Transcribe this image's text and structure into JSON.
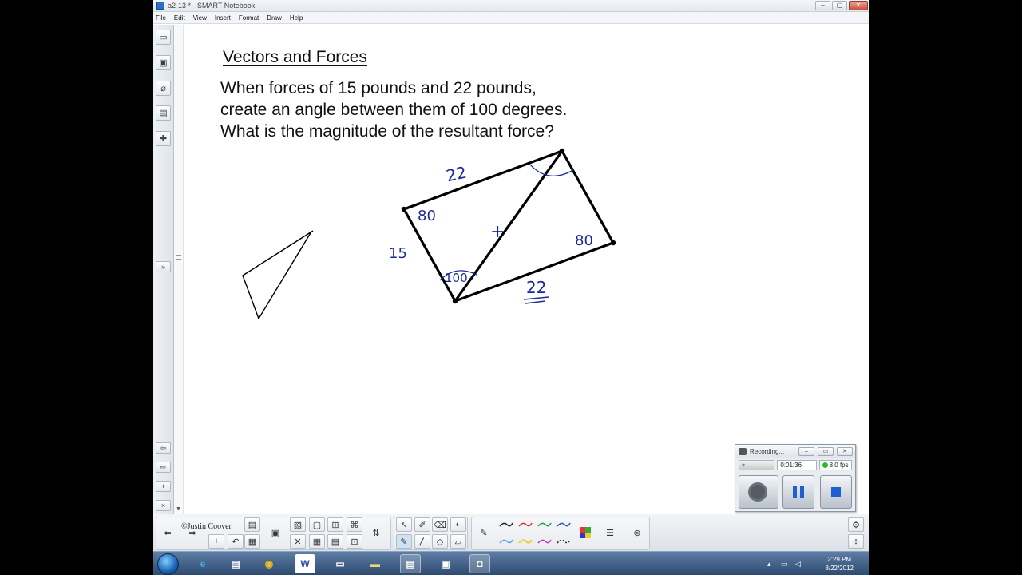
{
  "window": {
    "title": "a2-13 * - SMART Notebook",
    "min_glyph": "‒",
    "max_glyph": "▢",
    "close_glyph": "✕"
  },
  "menu": [
    "File",
    "Edit",
    "View",
    "Insert",
    "Format",
    "Draw",
    "Help"
  ],
  "slide": {
    "title": "Vectors and Forces",
    "problem": [
      "When forces of 15 pounds and 22 pounds,",
      "create an angle between them of 100 degrees.",
      "What is the magnitude of the resultant force?"
    ]
  },
  "annotations": {
    "top_side": "22",
    "left_angle": "80",
    "left_side": "15",
    "bottom_angle": "100",
    "diagonal_mark": "+",
    "right_angle": "80",
    "bottom_side": "22"
  },
  "recorder": {
    "title": "Recording...",
    "elapsed": "0:01:36",
    "fps": "8.0 fps"
  },
  "toolbar": {
    "copyright": "©Justin Coover"
  },
  "taskbar": {
    "time": "2:29 PM",
    "date": "8/22/2012",
    "word_glyph": "W"
  },
  "colors": {
    "ink": "#1b2a9a",
    "shape_stroke": "#000000",
    "recording_indicator": "#22c02a",
    "taskbar": "#2e4a70"
  },
  "icons": {
    "sidebar": [
      "page-sorter-icon",
      "gallery-icon",
      "attachments-icon",
      "properties-icon",
      "addons-icon"
    ],
    "recorder": [
      "record-icon",
      "pause-icon",
      "stop-icon"
    ]
  }
}
